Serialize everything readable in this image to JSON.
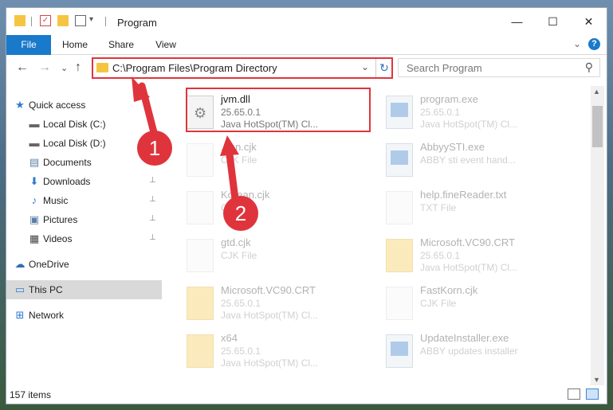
{
  "title_bar": {
    "title": "Program",
    "minimize": "—",
    "maximize": "☐",
    "close": "✕"
  },
  "ribbon": {
    "tabs": [
      {
        "label": "File"
      },
      {
        "label": "Home"
      },
      {
        "label": "Share"
      },
      {
        "label": "View"
      }
    ],
    "expand_glyph": "⌄",
    "help_glyph": "?"
  },
  "nav": {
    "back": "←",
    "forward": "→",
    "recent": "⌄",
    "up": "↑",
    "address": "C:\\Program Files\\Program Directory",
    "address_dropdown": "⌄",
    "refresh": "↻",
    "search_placeholder": "Search Program",
    "search_icon": "⚲"
  },
  "sidebar": {
    "items": [
      {
        "label": "Quick access",
        "icon": "star-icon",
        "glyph": "★",
        "color": "#2f7bd0",
        "pinned": false
      },
      {
        "label": "Local Disk (C:)",
        "icon": "drive-icon",
        "glyph": "▬",
        "color": "#666666",
        "pinned": true
      },
      {
        "label": "Local Disk (D:)",
        "icon": "drive-icon",
        "glyph": "▬",
        "color": "#666666",
        "pinned": false
      },
      {
        "label": "Documents",
        "icon": "documents-icon",
        "glyph": "▤",
        "color": "#5a7fa8",
        "pinned": true
      },
      {
        "label": "Downloads",
        "icon": "downloads-icon",
        "glyph": "⬇",
        "color": "#2f7bd0",
        "pinned": true
      },
      {
        "label": "Music",
        "icon": "music-icon",
        "glyph": "♪",
        "color": "#2f7bd0",
        "pinned": true
      },
      {
        "label": "Pictures",
        "icon": "pictures-icon",
        "glyph": "▣",
        "color": "#5a7fa8",
        "pinned": true
      },
      {
        "label": "Videos",
        "icon": "videos-icon",
        "glyph": "▦",
        "color": "#444444",
        "pinned": true
      },
      {
        "label": "OneDrive",
        "icon": "onedrive-icon",
        "glyph": "☁",
        "color": "#2f6db5",
        "pinned": false
      },
      {
        "label": "This PC",
        "icon": "pc-icon",
        "glyph": "▭",
        "color": "#2f7bd0",
        "pinned": false
      },
      {
        "label": "Network",
        "icon": "network-icon",
        "glyph": "⊞",
        "color": "#2f7bd0",
        "pinned": false
      }
    ],
    "pin_glyph": "📌"
  },
  "files": [
    {
      "name": "jvm.dll",
      "line2": "25.65.0.1",
      "line3": "Java HotSpot(TM) Cl...",
      "kind": "dll",
      "faded": false
    },
    {
      "name": "program.exe",
      "line2": "25.65.0.1",
      "line3": "Java HotSpot(TM) Cl...",
      "kind": "app",
      "faded": true
    },
    {
      "name": "...an.cjk",
      "line2": "CJK File",
      "line3": "",
      "kind": "doc",
      "faded": true
    },
    {
      "name": "AbbyySTI.exe",
      "line2": "ABBY sti event hand...",
      "line3": "",
      "kind": "app",
      "faded": true
    },
    {
      "name": "Korean.cjk",
      "line2": "CJK File",
      "line3": "",
      "kind": "doc",
      "faded": true
    },
    {
      "name": "help.fineReader.txt",
      "line2": "TXT File",
      "line3": "",
      "kind": "doc",
      "faded": true
    },
    {
      "name": "gtd.cjk",
      "line2": "CJK File",
      "line3": "",
      "kind": "doc",
      "faded": true
    },
    {
      "name": "Microsoft.VC90.CRT",
      "line2": "25.65.0.1",
      "line3": "Java HotSpot(TM) Cl...",
      "kind": "folder",
      "faded": true
    },
    {
      "name": "Microsoft.VC90.CRT",
      "line2": "25.65.0.1",
      "line3": "Java HotSpot(TM) Cl...",
      "kind": "folder",
      "faded": true
    },
    {
      "name": "FastKorn.cjk",
      "line2": "CJK File",
      "line3": "",
      "kind": "doc",
      "faded": true
    },
    {
      "name": "x64",
      "line2": "25.65.0.1",
      "line3": "Java HotSpot(TM) Cl...",
      "kind": "folder",
      "faded": true
    },
    {
      "name": "UpdateInstaller.exe",
      "line2": "ABBY updates installer",
      "line3": "",
      "kind": "app",
      "faded": true
    }
  ],
  "status": {
    "count": "157 items"
  },
  "callouts": [
    {
      "label": "1"
    },
    {
      "label": "2"
    }
  ],
  "colors": {
    "accent": "#1979ca",
    "highlight": "#e0343c",
    "folder": "#f5c542"
  }
}
